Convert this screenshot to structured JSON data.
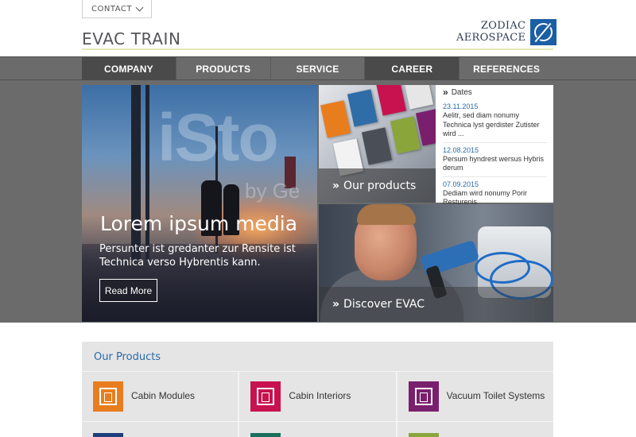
{
  "header": {
    "contact_label": "CONTACT",
    "brand_title": "EVAC TRAIN",
    "logo_line1": "ZODIAC",
    "logo_line2": "AEROSPACE"
  },
  "nav": {
    "items": [
      {
        "label": "COMPANY",
        "active": true
      },
      {
        "label": "PRODUCTS",
        "active": false
      },
      {
        "label": "SERVICE",
        "active": false
      },
      {
        "label": "CAREER",
        "active": false
      },
      {
        "label": "REFERENCES",
        "active": false
      }
    ]
  },
  "hero": {
    "watermark": "iSto",
    "watermark_small": "by Ge",
    "title": "Lorem ipsum media",
    "subtitle": "Persunter ist gredanter zur Rensite ist Technica verso Hybrentis kann.",
    "button_label": "Read More"
  },
  "tiles": {
    "products_caption": "Our products",
    "discover_caption": "Discover EVAC"
  },
  "dates": {
    "heading": "Dates",
    "entries": [
      {
        "date": "23.11.2015",
        "text": "Aelitr, sed diam nonumy Technica lyst gerdister Zutister wird ..."
      },
      {
        "date": "12.08.2015",
        "text": "Persum hyndrest wersus Hybris derum"
      },
      {
        "date": "07.09.2015",
        "text": "Dediam wird nonumy Porir Resturenis"
      }
    ]
  },
  "products": {
    "title": "Our Products",
    "items": [
      {
        "label": "Cabin Modules",
        "color": "#e87d1e"
      },
      {
        "label": "Cabin Interiors",
        "color": "#c8124f"
      },
      {
        "label": "Vacuum Toilet Systems",
        "color": "#7a1f6d"
      }
    ],
    "row2_colors": [
      "#1f3f7a",
      "#1d6e5c",
      "#8aa63b"
    ]
  },
  "colors": {
    "nav_bg": "#6b6b6b",
    "nav_active": "#4a4a4a",
    "link_blue": "#2a6aa8",
    "logo_blue": "#1b5ea4"
  }
}
